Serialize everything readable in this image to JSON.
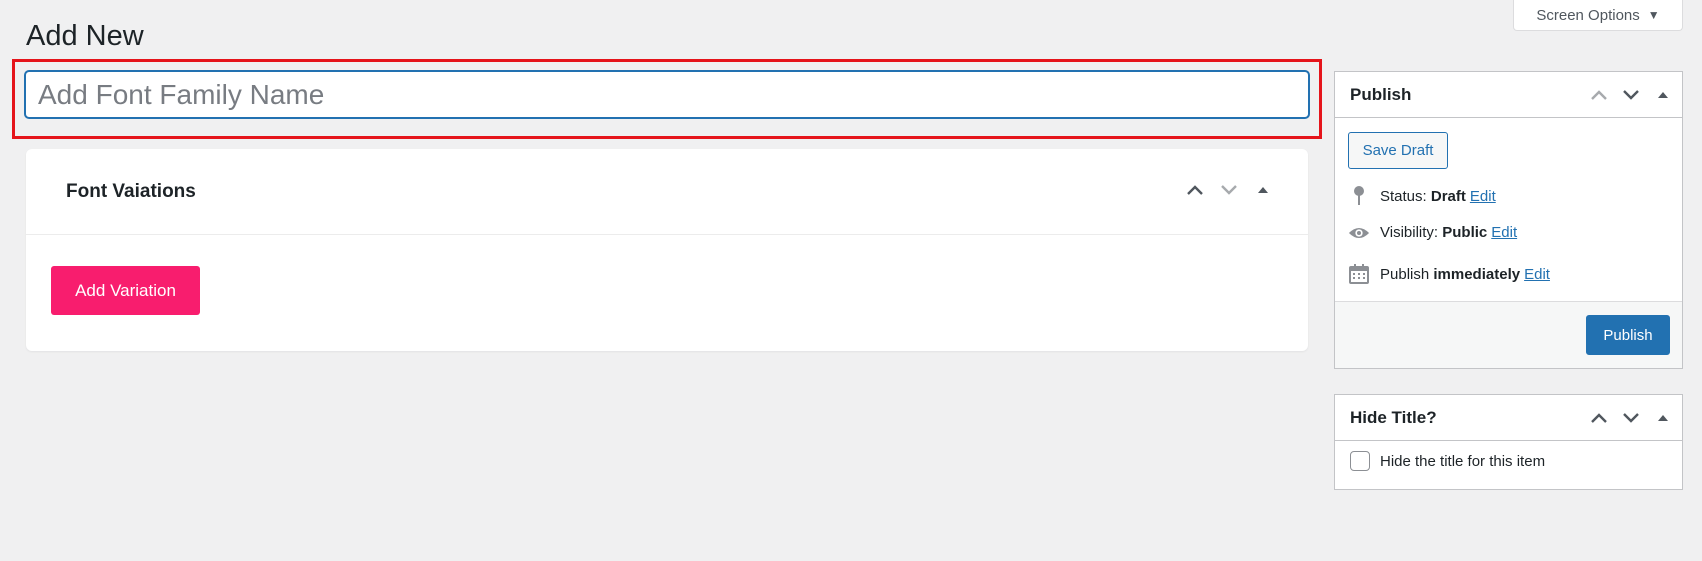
{
  "screen_options": {
    "label": "Screen Options",
    "caret_icon": "triangle-down-icon"
  },
  "page": {
    "title": "Add New"
  },
  "title_field": {
    "placeholder": "Add Font Family Name",
    "value": ""
  },
  "variations": {
    "title": "Font Vaiations",
    "add_button": "Add Variation",
    "handles": [
      "chevron-up-icon",
      "chevron-down-icon",
      "triangle-up-icon"
    ]
  },
  "publish": {
    "title": "Publish",
    "save_draft": "Save Draft",
    "status_label": "Status:",
    "status_value": "Draft",
    "visibility_label": "Visibility:",
    "visibility_value": "Public",
    "publish_label": "Publish",
    "publish_value": "immediately",
    "edit_link": "Edit",
    "publish_button": "Publish"
  },
  "hide_title": {
    "title": "Hide Title?",
    "checkbox_label": "Hide the title for this item",
    "checked": false
  },
  "colors": {
    "background": "#f0f0f1",
    "primary": "#2271b1",
    "accent_pink": "#f81d6e",
    "highlight_red": "#e5141b"
  }
}
